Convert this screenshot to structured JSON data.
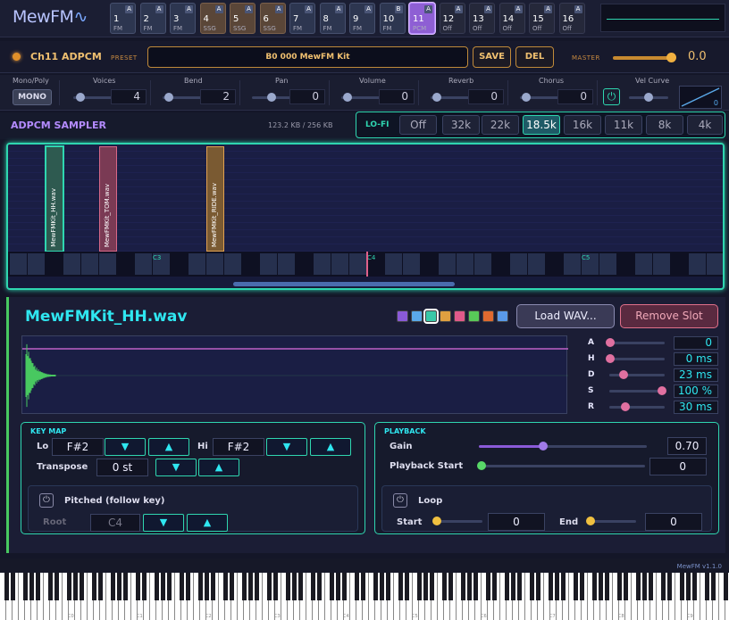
{
  "app": {
    "logo": "MewFM",
    "version": "MewFM v1.1.0"
  },
  "channels": [
    {
      "num": "1",
      "type": "FM",
      "badge": "A"
    },
    {
      "num": "2",
      "type": "FM",
      "badge": "A"
    },
    {
      "num": "3",
      "type": "FM",
      "badge": "A"
    },
    {
      "num": "4",
      "type": "SSG",
      "badge": "A"
    },
    {
      "num": "5",
      "type": "SSG",
      "badge": "A"
    },
    {
      "num": "6",
      "type": "SSG",
      "badge": "A"
    },
    {
      "num": "7",
      "type": "FM",
      "badge": "A"
    },
    {
      "num": "8",
      "type": "FM",
      "badge": "A"
    },
    {
      "num": "9",
      "type": "FM",
      "badge": "A"
    },
    {
      "num": "10",
      "type": "FM",
      "badge": "B"
    },
    {
      "num": "11",
      "type": "PCM",
      "badge": "A"
    },
    {
      "num": "12",
      "type": "Off",
      "badge": "A"
    },
    {
      "num": "13",
      "type": "Off",
      "badge": "A"
    },
    {
      "num": "14",
      "type": "Off",
      "badge": "A"
    },
    {
      "num": "15",
      "type": "Off",
      "badge": "A"
    },
    {
      "num": "16",
      "type": "Off",
      "badge": "A"
    }
  ],
  "preset": {
    "channel_label": "Ch11 ADPCM",
    "preset_label": "PRESET",
    "preset_name": "B0 000 MewFM Kit",
    "save": "SAVE",
    "del": "DEL",
    "master_label": "MASTER",
    "master_value": "0.0",
    "master_level": 0.95
  },
  "params": {
    "mono_poly_label": "Mono/Poly",
    "mono_btn": "MONO",
    "voices": {
      "label": "Voices",
      "value": "4",
      "level": 0.1
    },
    "bend": {
      "label": "Bend",
      "value": "2",
      "level": 0.05
    },
    "pan": {
      "label": "Pan",
      "value": "0",
      "level": 0.5
    },
    "volume": {
      "label": "Volume",
      "value": "0",
      "level": 0.05
    },
    "reverb": {
      "label": "Reverb",
      "value": "0",
      "level": 0.05
    },
    "chorus": {
      "label": "Chorus",
      "value": "0",
      "level": 0.05
    },
    "vel_curve": {
      "label": "Vel Curve",
      "value": "0",
      "level": 0.5
    }
  },
  "sampler": {
    "title": "ADPCM SAMPLER",
    "size": "123.2 KB / 256 KB",
    "lofi_label": "LO-FI",
    "lofi": [
      "Off",
      "32k",
      "22k",
      "18.5k",
      "16k",
      "11k",
      "8k",
      "4k"
    ],
    "lofi_active": "18.5k"
  },
  "keymap_view": {
    "slots": [
      {
        "name": "MewFMKit_HH.wav",
        "color": "#2fd6b0",
        "fill": "#2e5a50"
      },
      {
        "name": "MewFMKit_TOM.wav",
        "color": "#d86888",
        "fill": "#7a3a54"
      },
      {
        "name": "MewFMKit_RIDE.wav",
        "color": "#e0a050",
        "fill": "#7a5a32"
      }
    ],
    "octave_labels": [
      "C3",
      "C4",
      "C5"
    ]
  },
  "editor": {
    "file_name": "MewFMKit_HH.wav",
    "swatches": [
      "#8a5ad8",
      "#5aa8e8",
      "#38c8a8",
      "#e0a040",
      "#e05a8a",
      "#58c858",
      "#e06a30",
      "#5a9ae8"
    ],
    "load": "Load WAV...",
    "remove": "Remove Slot",
    "adsr": [
      {
        "label": "A",
        "value": "0",
        "level": 0.0
      },
      {
        "label": "H",
        "value": "0 ms",
        "level": 0.0
      },
      {
        "label": "D",
        "value": "23 ms",
        "level": 0.25
      },
      {
        "label": "S",
        "value": "100 %",
        "level": 1.0
      },
      {
        "label": "R",
        "value": "30 ms",
        "level": 0.3
      }
    ],
    "keymap": {
      "title": "KEY MAP",
      "lo_label": "Lo",
      "lo_value": "F#2",
      "hi_label": "Hi",
      "hi_value": "F#2",
      "transpose_label": "Transpose",
      "transpose_value": "0 st",
      "pitched_label": "Pitched  (follow key)",
      "root_label": "Root",
      "root_value": "C4"
    },
    "playback": {
      "title": "PLAYBACK",
      "gain_label": "Gain",
      "gain_value": "0.70",
      "gain_level": 0.7,
      "start_label": "Playback Start",
      "start_value": "0",
      "loop_label": "Loop",
      "loop_start_label": "Start",
      "loop_start_value": "0",
      "loop_end_label": "End",
      "loop_end_value": "0"
    }
  },
  "piano": {
    "labels": [
      "C0",
      "C1",
      "C2",
      "C3",
      "C4",
      "C5",
      "C6",
      "C7",
      "C8",
      "C9"
    ]
  },
  "icons": {
    "down": "▼",
    "up": "▲",
    "power": "⏻"
  }
}
